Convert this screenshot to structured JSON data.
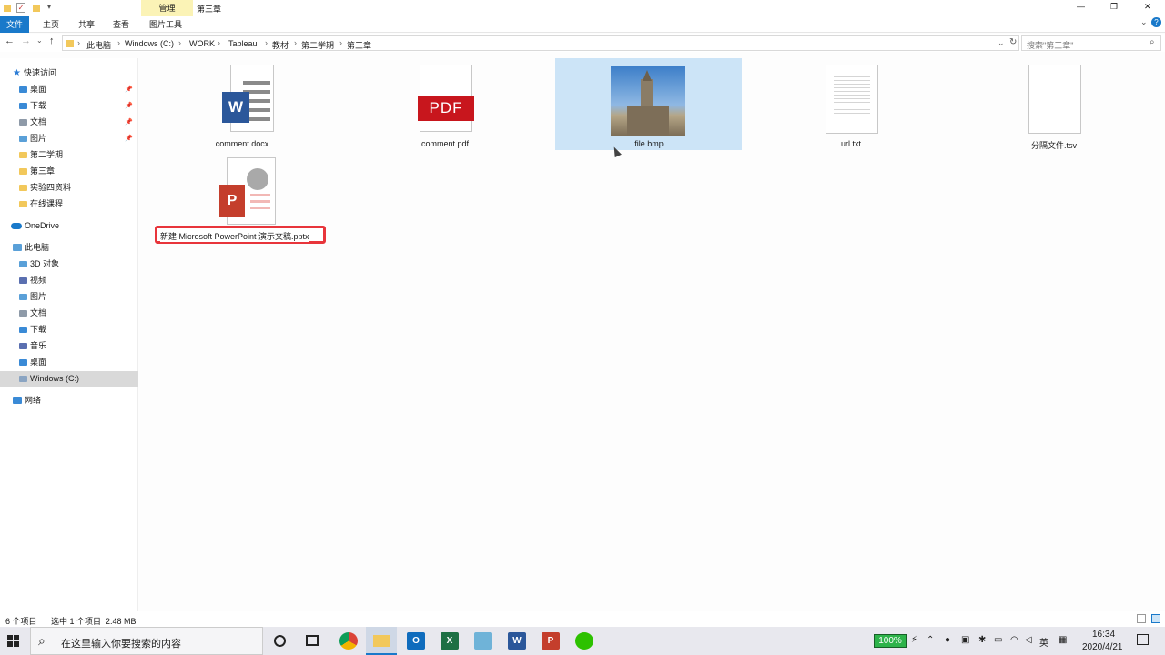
{
  "window": {
    "title": "第三章",
    "manage_tab": "管理",
    "controls": {
      "minimize": "—",
      "maximize": "❐",
      "close": "✕"
    }
  },
  "ribbon": {
    "tabs": [
      "文件",
      "主页",
      "共享",
      "查看",
      "图片工具"
    ]
  },
  "address": {
    "crumbs": [
      "此电脑",
      "Windows (C:)",
      "WORK",
      "Tableau",
      "教材",
      "第二学期",
      "第三章"
    ],
    "search_placeholder": "搜索\"第三章\""
  },
  "sidebar": {
    "quick_access": "快速访问",
    "quick_items": [
      {
        "label": "桌面",
        "pinned": true,
        "color": "#3a8ad6"
      },
      {
        "label": "下载",
        "pinned": true,
        "color": "#3a8ad6"
      },
      {
        "label": "文档",
        "pinned": true,
        "color": "#8e9aa8"
      },
      {
        "label": "图片",
        "pinned": true,
        "color": "#5aa0d8"
      },
      {
        "label": "第二学期",
        "pinned": false,
        "color": "#f2c85b"
      },
      {
        "label": "第三章",
        "pinned": false,
        "color": "#f2c85b"
      },
      {
        "label": "实验四资料",
        "pinned": false,
        "color": "#f2c85b"
      },
      {
        "label": "在线课程",
        "pinned": false,
        "color": "#f2c85b"
      }
    ],
    "onedrive": "OneDrive",
    "this_pc": "此电脑",
    "pc_items": [
      {
        "label": "3D 对象",
        "color": "#5aa0d8"
      },
      {
        "label": "视频",
        "color": "#5a6fb0"
      },
      {
        "label": "图片",
        "color": "#5aa0d8"
      },
      {
        "label": "文档",
        "color": "#8e9aa8"
      },
      {
        "label": "下载",
        "color": "#3a8ad6"
      },
      {
        "label": "音乐",
        "color": "#5a6fb0"
      },
      {
        "label": "桌面",
        "color": "#3a8ad6"
      },
      {
        "label": "Windows (C:)",
        "color": "#8aa4c2"
      }
    ],
    "network": "网络"
  },
  "files": [
    {
      "name": "comment.docx",
      "kind": "word-icon"
    },
    {
      "name": "comment.pdf",
      "kind": "pdf-icon"
    },
    {
      "name": "file.bmp",
      "kind": "image-icon",
      "selected": true
    },
    {
      "name": "url.txt",
      "kind": "text-icon"
    },
    {
      "name": "分隔文件.tsv",
      "kind": "generic-file-icon"
    },
    {
      "name": "新建 Microsoft PowerPoint 演示文稿.pptx",
      "kind": "powerpoint-icon",
      "renaming": true
    }
  ],
  "icon_text": {
    "word": "W",
    "pdf": "PDF",
    "ppt": "P"
  },
  "status": {
    "count": "6 个项目",
    "selection": "选中 1 个项目  2.48 MB"
  },
  "taskbar": {
    "search_placeholder": "在这里输入你要搜索的内容",
    "battery": "100%",
    "ime": "英",
    "time": "16:34",
    "date": "2020/4/21"
  },
  "colors": {
    "accent": "#1979ca",
    "selection": "#cce4f7",
    "rename_border": "#e8353b",
    "manage_bg": "#fbf3b6"
  }
}
